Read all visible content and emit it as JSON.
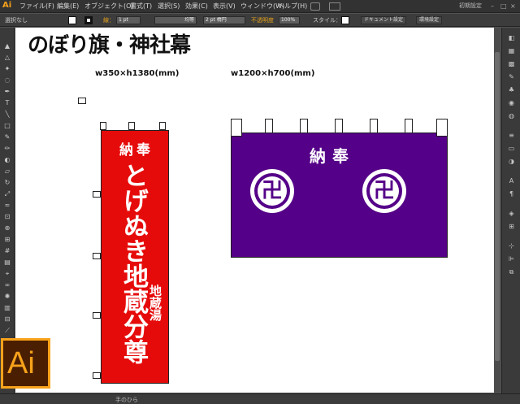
{
  "app": {
    "logo_mini": "Ai",
    "workspace": "初期設定",
    "menus": [
      "ファイル(F)",
      "編集(E)",
      "オブジェクト(O)",
      "書式(T)",
      "選択(S)",
      "効果(C)",
      "表示(V)",
      "ウィンドウ(W)",
      "ヘルプ(H)"
    ],
    "window_controls": [
      "–",
      "□",
      "×"
    ]
  },
  "control_bar": {
    "selection_state": "選択なし",
    "stroke_label": "線：",
    "stroke_weight": "1 pt",
    "stroke_style": "均等",
    "brush": "2 pt 楕円",
    "opacity_label": "不透明度",
    "opacity_value": "100%",
    "style_label": "スタイル：",
    "document_settings": "ドキュメント設定",
    "preferences": "環境設定"
  },
  "artwork": {
    "page_title": "のぼり旗・神社幕",
    "nobori_size": "w350×h1380(mm)",
    "curtain_size": "w1200×h700(mm)",
    "nobori_top": "納奉",
    "nobori_main": "とげぬき地蔵分尊",
    "nobori_sub": "地蔵湯",
    "curtain_text": "納奉",
    "crest_mark": "卍"
  },
  "status_bar": {
    "tool_name": "手のひら"
  },
  "logo": {
    "text": "Ai",
    "accent_color": "#f7a21b"
  },
  "colors": {
    "nobori_red": "#e60b0b",
    "curtain_purple": "#550088"
  }
}
